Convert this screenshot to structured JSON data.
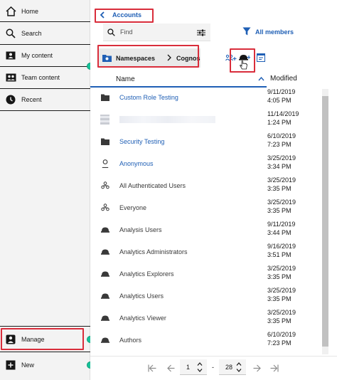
{
  "nav": {
    "home": "Home",
    "search": "Search",
    "my_content": "My content",
    "team_content": "Team content",
    "recent": "Recent",
    "manage": "Manage",
    "new": "New"
  },
  "header": {
    "back_label": "Accounts",
    "search_placeholder": "Find",
    "filter_label": "All members"
  },
  "breadcrumb": {
    "root": "Namespaces",
    "current": "Cognos"
  },
  "table": {
    "col_name": "Name",
    "col_modified": "Modified",
    "rows": [
      {
        "name": "Custom Role Testing",
        "icon": "folder-icon",
        "date": "9/11/2019",
        "time": "4:05 PM",
        "link": true
      },
      {
        "name": "",
        "icon": "redacted-icon",
        "date": "11/14/2019",
        "time": "1:24 PM",
        "link": false
      },
      {
        "name": "Security Testing",
        "icon": "folder-icon",
        "date": "6/10/2019",
        "time": "7:23 PM",
        "link": true
      },
      {
        "name": "Anonymous",
        "icon": "user-icon",
        "date": "3/25/2019",
        "time": "3:34 PM",
        "link": true
      },
      {
        "name": "All Authenticated Users",
        "icon": "group-icon",
        "date": "3/25/2019",
        "time": "3:35 PM",
        "link": false
      },
      {
        "name": "Everyone",
        "icon": "group-icon",
        "date": "3/25/2019",
        "time": "3:35 PM",
        "link": false
      },
      {
        "name": "Analysis Users",
        "icon": "role-icon",
        "date": "9/11/2019",
        "time": "3:44 PM",
        "link": false
      },
      {
        "name": "Analytics Administrators",
        "icon": "role-icon",
        "date": "9/16/2019",
        "time": "3:51 PM",
        "link": false
      },
      {
        "name": "Analytics Explorers",
        "icon": "role-icon",
        "date": "3/25/2019",
        "time": "3:35 PM",
        "link": false
      },
      {
        "name": "Analytics Users",
        "icon": "role-icon",
        "date": "3/25/2019",
        "time": "3:35 PM",
        "link": false
      },
      {
        "name": "Analytics Viewer",
        "icon": "role-icon",
        "date": "3/25/2019",
        "time": "3:35 PM",
        "link": false
      },
      {
        "name": "Authors",
        "icon": "role-icon",
        "date": "6/10/2019",
        "time": "7:23 PM",
        "link": false
      }
    ]
  },
  "pager": {
    "current_page": "1",
    "separator": "-",
    "total_pages": "28"
  },
  "colors": {
    "accent": "#1f5fb5",
    "highlight": "#d92d3b",
    "indicator": "#17c39a"
  }
}
